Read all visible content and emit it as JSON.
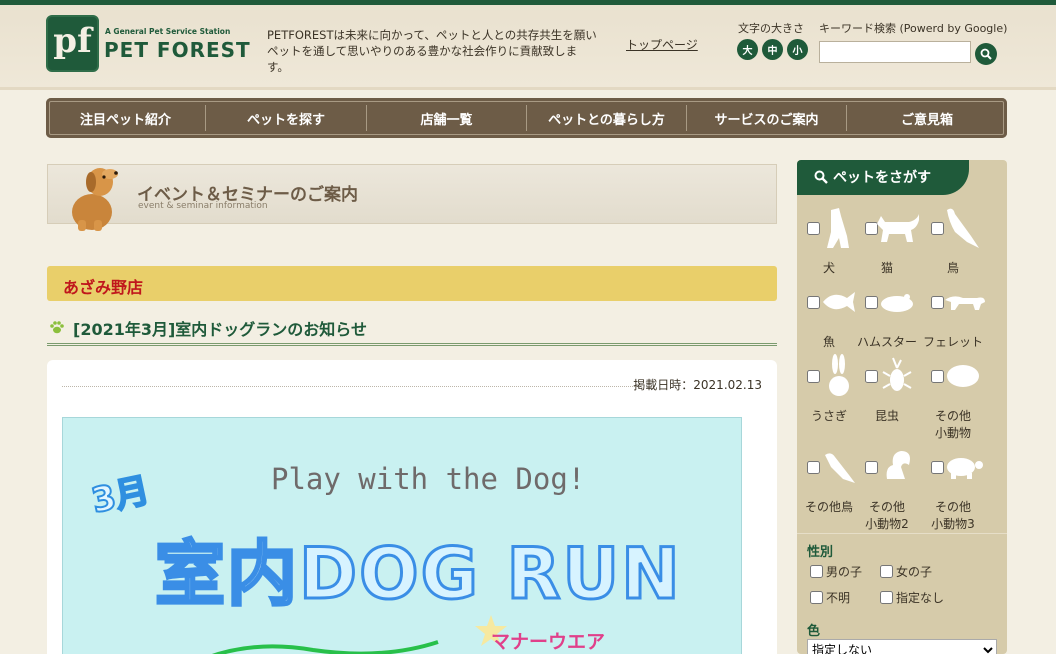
{
  "header": {
    "logo_tag": "A General Pet Service Station",
    "logo_name": "PET FOREST",
    "logo_mark": "pf",
    "tagline": "PETFORESTは未来に向かって、ペットと人との共存共生を願いペットを通して思いやりのある豊かな社会作りに貢献致します。",
    "top_link": "トップページ",
    "font_size_label": "文字の大きさ",
    "font_sizes": [
      "大",
      "中",
      "小"
    ],
    "search_label": "キーワード検索 (Powerd by Google)",
    "search_value": ""
  },
  "nav": [
    "注目ペット紹介",
    "ペットを探す",
    "店舗一覧",
    "ペットとの暮らし方",
    "サービスのご案内",
    "ご意見箱"
  ],
  "banner": {
    "title": "イベント＆セミナーのご案内",
    "subtitle": "event & seminar information"
  },
  "store": "あざみ野店",
  "post": {
    "title": "[2021年3月]室内ドッグランのお知らせ",
    "date": "掲載日時：2021.02.13",
    "flyer": {
      "play": "Play with the Dog!",
      "month": "3月",
      "main": "室内DOG RUN",
      "manner": "マナーウエア"
    }
  },
  "sidebar": {
    "title": "ペットをさがす",
    "pets": [
      {
        "label": "犬",
        "icon": "dog-icon"
      },
      {
        "label": "猫",
        "icon": "cat-icon"
      },
      {
        "label": "鳥",
        "icon": "bird-icon"
      },
      {
        "label": "魚",
        "icon": "fish-icon"
      },
      {
        "label": "ハムスター",
        "icon": "hamster-icon"
      },
      {
        "label": "フェレット",
        "icon": "ferret-icon"
      },
      {
        "label": "うさぎ",
        "icon": "rabbit-icon"
      },
      {
        "label": "昆虫",
        "icon": "beetle-icon"
      },
      {
        "label": "その他\n小動物",
        "icon": "small-animal-icon"
      },
      {
        "label": "その他鳥",
        "icon": "other-bird-icon"
      },
      {
        "label": "その他\n小動物2",
        "icon": "squirrel-icon"
      },
      {
        "label": "その他\n小動物3",
        "icon": "turtle-icon"
      }
    ],
    "gender_title": "性別",
    "genders": [
      "男の子",
      "女の子",
      "不明",
      "指定なし"
    ],
    "color_title": "色",
    "color_value": "指定しない"
  },
  "colors": {
    "brand_green": "#1f5a3a",
    "nav_brown": "#6d5c47",
    "store_band": "#e9cf6a",
    "store_text": "#c0171c"
  }
}
